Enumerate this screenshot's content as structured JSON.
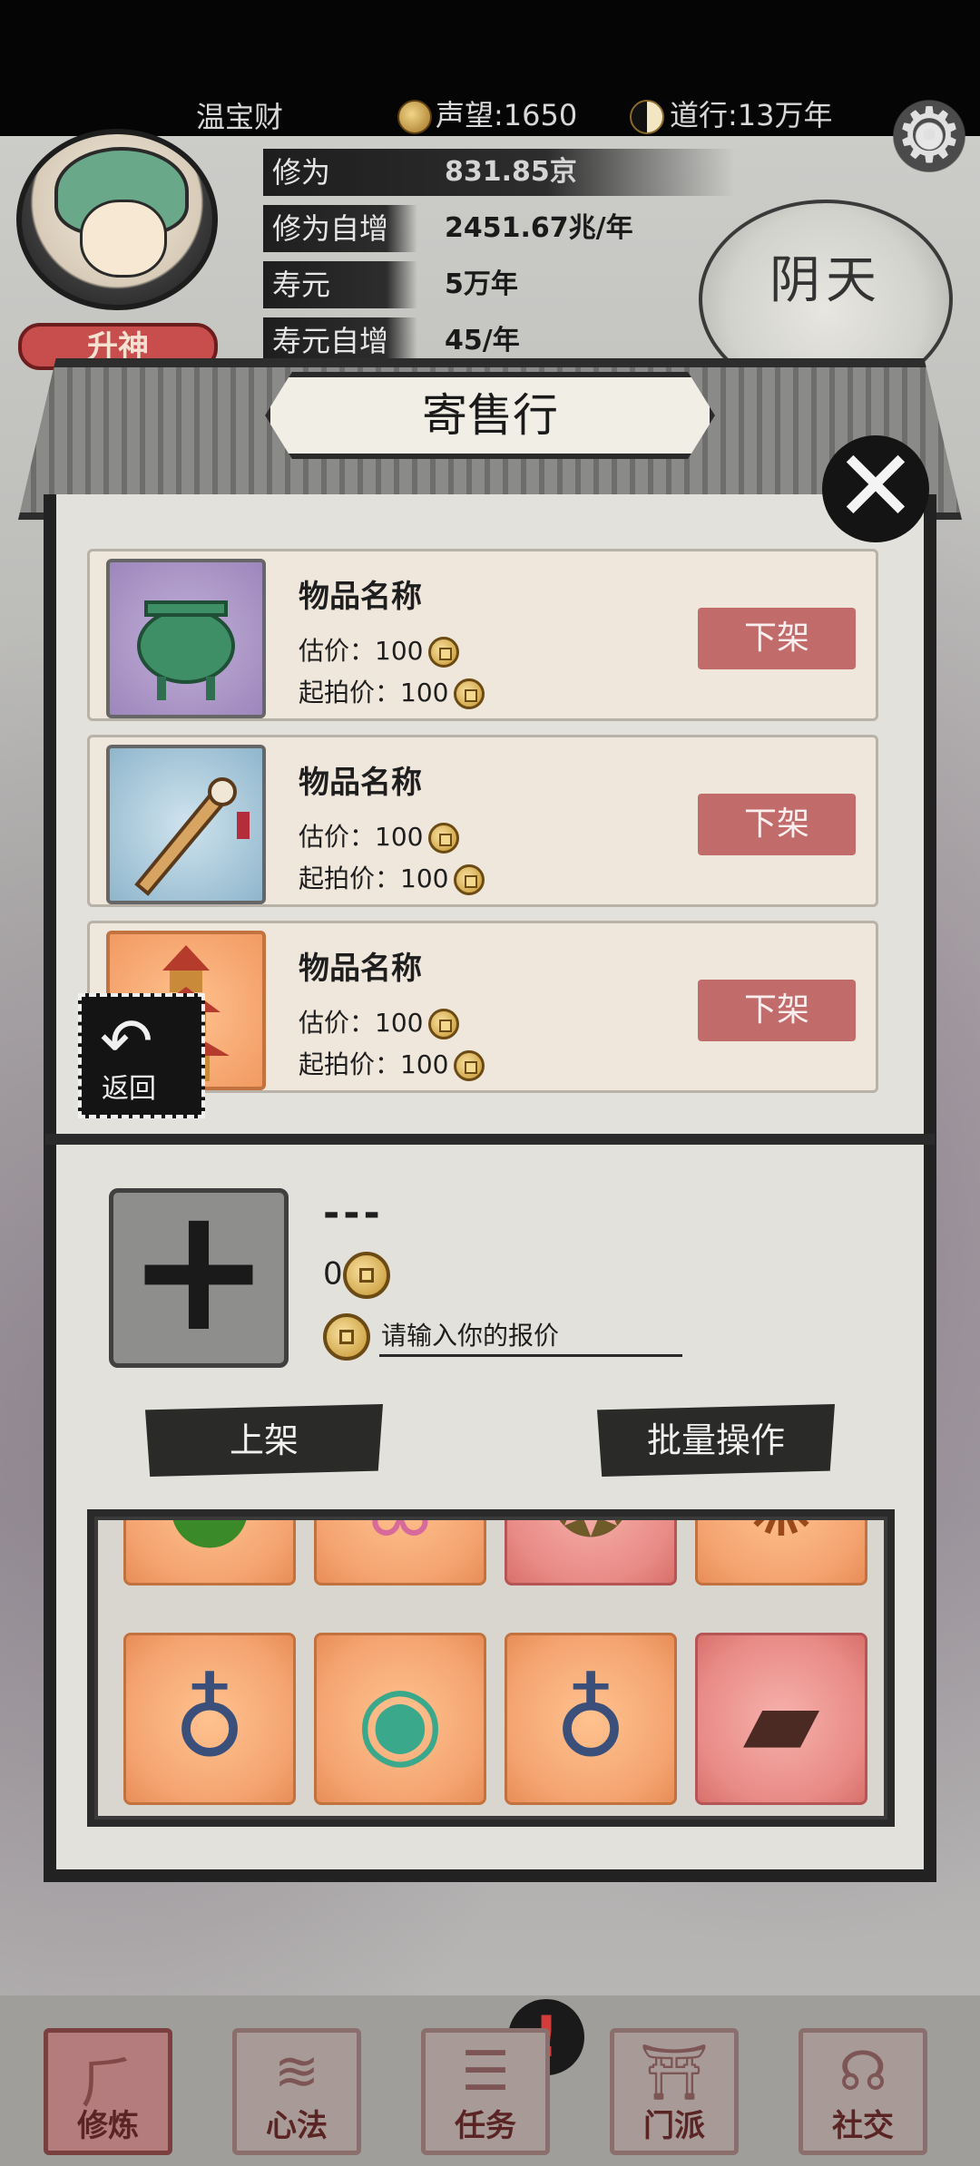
{
  "header": {
    "player_name": "温宝财",
    "reputation": "声望:1650",
    "dao": "道行:13万年",
    "stats": [
      {
        "label": "修为",
        "value": "831.85京"
      },
      {
        "label": "修为自增",
        "value": "2451.67兆/年"
      },
      {
        "label": "寿元",
        "value": "5万年"
      },
      {
        "label": "寿元自增",
        "value": "45/年"
      }
    ],
    "ascend_button": "升神",
    "weather": "阴天"
  },
  "dialog": {
    "title": "寄售行",
    "listings": [
      {
        "name": "物品名称",
        "estimate": "估价：100",
        "start_price": "起拍价：100",
        "action": "下架",
        "icon": "bronze-cauldron-icon"
      },
      {
        "name": "物品名称",
        "estimate": "估价：100",
        "start_price": "起拍价：100",
        "action": "下架",
        "icon": "sword-icon"
      },
      {
        "name": "物品名称",
        "estimate": "估价：100",
        "start_price": "起拍价：100",
        "action": "下架",
        "icon": "pagoda-icon"
      }
    ],
    "back_label": "返回",
    "sell": {
      "selected_name": "---",
      "selected_value": "0",
      "bid_placeholder": "请输入你的报价",
      "list_button": "上架",
      "batch_button": "批量操作"
    },
    "inventory": [
      {
        "icon": "pill-icon",
        "glyph": "●",
        "style": "orange"
      },
      {
        "icon": "lotus-scroll-icon",
        "glyph": "❀",
        "style": "orange"
      },
      {
        "icon": "bronze-mask-icon",
        "glyph": "❂",
        "style": "red"
      },
      {
        "icon": "amulet-icon",
        "glyph": "✺",
        "style": "orange"
      },
      {
        "icon": "gourd-icon",
        "glyph": "♁",
        "style": "orange"
      },
      {
        "icon": "jade-orb-icon",
        "glyph": "◉",
        "style": "orange"
      },
      {
        "icon": "gourd-icon",
        "glyph": "♁",
        "style": "orange"
      },
      {
        "icon": "guqin-icon",
        "glyph": "▰",
        "style": "red"
      }
    ]
  },
  "nav": [
    {
      "label": "修炼",
      "glyph": "⺁"
    },
    {
      "label": "心法",
      "glyph": "≋"
    },
    {
      "label": "任务",
      "glyph": "☰"
    },
    {
      "label": "门派",
      "glyph": "⛩"
    },
    {
      "label": "社交",
      "glyph": "☊"
    }
  ],
  "alert_glyph": "!"
}
